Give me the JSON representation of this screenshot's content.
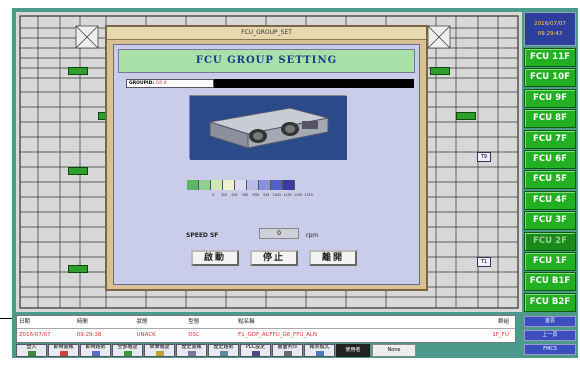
{
  "clock": {
    "date": "2016/07/07",
    "time": "09:29:43"
  },
  "floors": [
    {
      "label": "FCU 11F",
      "active": false
    },
    {
      "label": "FCU 10F",
      "active": false
    },
    {
      "label": "FCU 9F",
      "active": false
    },
    {
      "label": "FCU 8F",
      "active": false
    },
    {
      "label": "FCU 7F",
      "active": false
    },
    {
      "label": "FCU 6F",
      "active": false
    },
    {
      "label": "FCU 5F",
      "active": false
    },
    {
      "label": "FCU 4F",
      "active": false
    },
    {
      "label": "FCU 3F",
      "active": false
    },
    {
      "label": "FCU 2F",
      "active": true
    },
    {
      "label": "FCU 1F",
      "active": false
    },
    {
      "label": "FCU B1F",
      "active": false
    },
    {
      "label": "FCU B2F",
      "active": false
    }
  ],
  "plan": {
    "t_labels": [
      "T9",
      "T1"
    ]
  },
  "modal": {
    "window_title": "FCU_GROUP_SET",
    "heading": "FCU GROUP SETTING",
    "group_label": "GROUPID: ",
    "group_value": "G6-4",
    "scale_colors": [
      "#5cb85c",
      "#8fd08f",
      "#cde8b0",
      "#eef2d0",
      "#dcdcf4",
      "#b8bce8",
      "#8890d8",
      "#5560c4",
      "#3a3aa0"
    ],
    "scale_ticks": [
      "0",
      "315",
      "535",
      "765",
      "930",
      "915",
      "1035",
      "1135",
      "1150",
      "1315"
    ],
    "speed_label": "SPEED SF",
    "speed_value": "0",
    "speed_unit": "rpm",
    "buttons": {
      "start": "啟動",
      "stop": "停止",
      "leave": "離開"
    }
  },
  "alarm": {
    "headers": [
      "日期",
      "時間",
      "狀態",
      "型態",
      "點名稱",
      "群組"
    ],
    "row": [
      "2016/07/07",
      "09:29:38",
      "UNACK",
      "DSC",
      "F1_GDF_ACFFU_G6_FFU_ALN",
      "1F_FU"
    ]
  },
  "toolbar": [
    "登入",
    "即時警報",
    "即時趨勢",
    "全部確認",
    "單筆確認",
    "歷史警報",
    "歷史趨勢",
    "PLC設定",
    "畫面列印",
    "報表模式"
  ],
  "user": {
    "label": "使用者",
    "value": "None"
  },
  "side_buttons": [
    "首頁",
    "上一頁",
    "FMCS"
  ]
}
